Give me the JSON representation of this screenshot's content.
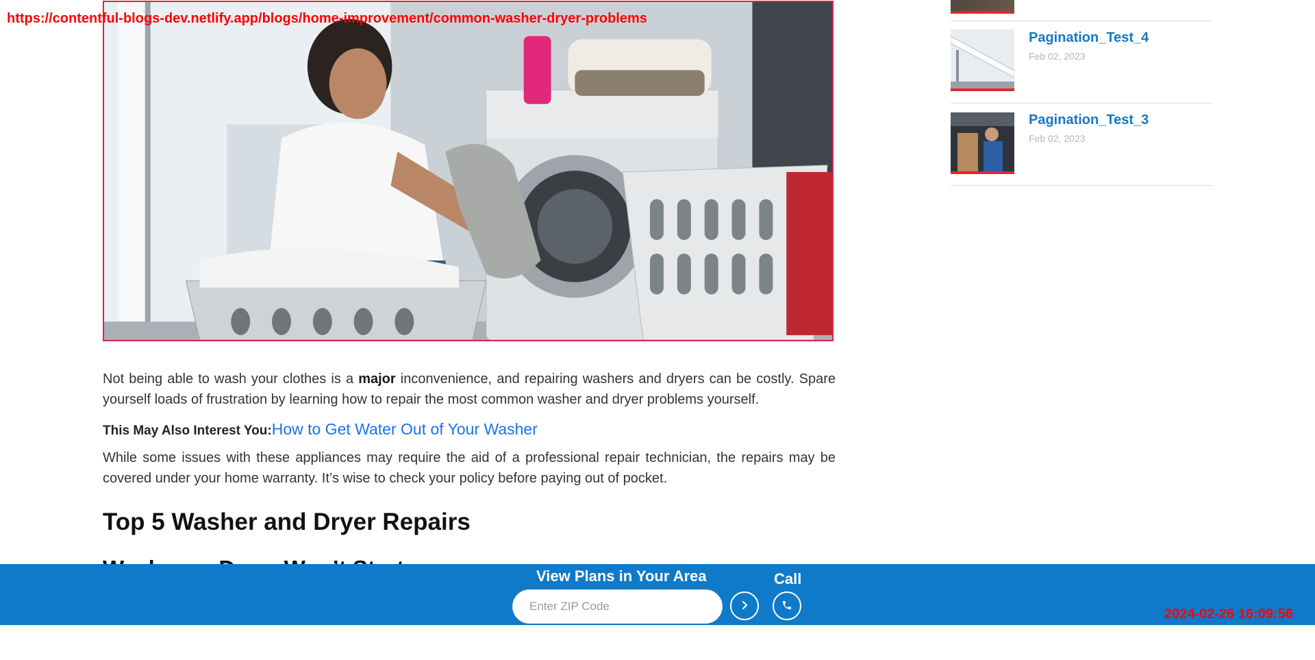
{
  "overlay": {
    "url": "https://contentful-blogs-dev.netlify.app/blogs/home-improvement/common-washer-dryer-problems",
    "timestamp": "2024-02-26 16:09:56"
  },
  "article": {
    "hero_alt": "Woman loading laundry from a washing machine",
    "p1_before": "Not being able to wash your clothes is a ",
    "p1_bold": "major",
    "p1_after": " inconvenience, and repairing washers and dryers can be costly. Spare yourself loads of frustration by learning how to repair the most common washer and dryer problems yourself.",
    "interest_label": "This May Also Interest You:",
    "interest_link": "How to Get Water Out of Your Washer",
    "p2": "While some issues with these appliances may require the aid of a professional repair technician, the repairs may be covered under your home warranty. It’s wise to check your policy before paying out of pocket.",
    "heading": "Top 5 Washer and Dryer Repairs",
    "subheading_partial": "Washer or Dryer Won’t Start"
  },
  "sidebar": {
    "items": [
      {
        "title": "Pagination_Test_4",
        "date": "Feb 02, 2023"
      },
      {
        "title": "Pagination_Test_3",
        "date": "Feb 02, 2023"
      }
    ]
  },
  "bar": {
    "title": "View Plans in Your Area",
    "zip_placeholder": "Enter ZIP Code",
    "call_label": "Call",
    "go_icon": "chevron-right-icon",
    "call_icon": "phone-icon",
    "color": "#0f7ac9"
  }
}
